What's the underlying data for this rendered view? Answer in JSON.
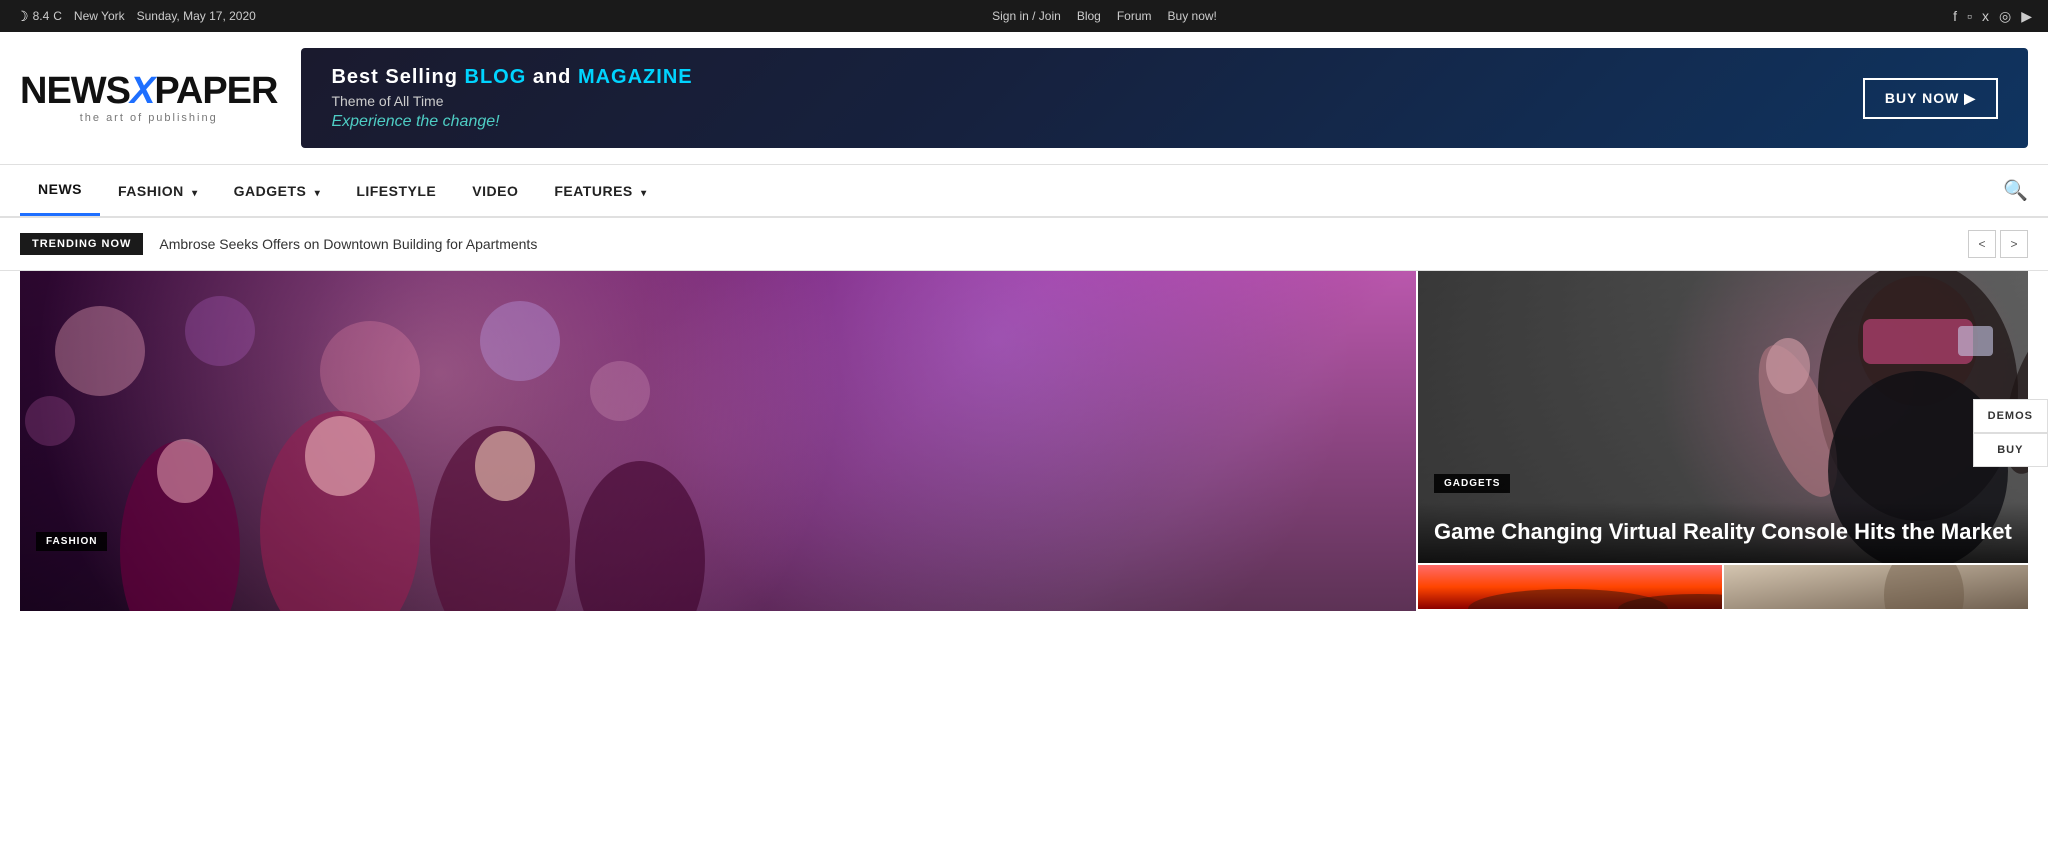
{
  "topbar": {
    "weather_icon": "☽",
    "temperature": "8.4",
    "temp_unit": "C",
    "location": "New York",
    "date": "Sunday, May 17, 2020",
    "signin": "Sign in / Join",
    "blog": "Blog",
    "forum": "Forum",
    "buy_now": "Buy now!",
    "socials": [
      "f",
      "📷",
      "🐦",
      "v",
      "▶"
    ]
  },
  "side_buttons": {
    "demos": "DEMOS",
    "buy": "BUY"
  },
  "logo": {
    "part1": "NEWS",
    "x": "X",
    "part2": "PAPER",
    "subtitle": "the art of publishing"
  },
  "ad_banner": {
    "line1a": "Best Selling ",
    "line1b": "BLOG",
    "line1c": " and ",
    "line1d": "MAGAZINE",
    "line2": "Theme of All Time",
    "tagline": "Experience the change!",
    "buy_btn": "BUY NOW"
  },
  "nav": {
    "items": [
      {
        "label": "NEWS",
        "active": true,
        "has_dropdown": false
      },
      {
        "label": "FASHION",
        "active": false,
        "has_dropdown": true
      },
      {
        "label": "GADGETS",
        "active": false,
        "has_dropdown": true
      },
      {
        "label": "LIFESTYLE",
        "active": false,
        "has_dropdown": false
      },
      {
        "label": "VIDEO",
        "active": false,
        "has_dropdown": false
      },
      {
        "label": "FEATURES",
        "active": false,
        "has_dropdown": true
      }
    ],
    "search_icon": "🔍"
  },
  "trending": {
    "badge": "TRENDING NOW",
    "text": "Ambrose Seeks Offers on Downtown Building for Apartments",
    "prev_icon": "<",
    "next_icon": ">"
  },
  "articles": {
    "left": {
      "category": "FASHION",
      "title": ""
    },
    "right_top": {
      "category": "GADGETS",
      "title": "Game Changing Virtual Reality Console Hits the Market"
    }
  }
}
